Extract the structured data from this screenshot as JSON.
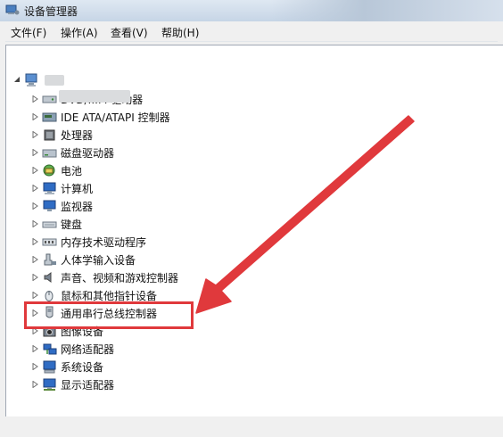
{
  "window": {
    "title": "设备管理器"
  },
  "menubar": [
    "文件(F)",
    "操作(A)",
    "查看(V)",
    "帮助(H)"
  ],
  "toolbar": [
    "back-icon",
    "forward-icon",
    "show-hide-tree-icon",
    "properties-icon",
    "help-icon",
    "action-pane-icon",
    "scan-hardware-icon"
  ],
  "tree": {
    "root_label_obscured": true,
    "items": [
      {
        "label": "DVD/...M 驱动器",
        "icon": "dvd-drive-icon"
      },
      {
        "label": "IDE ATA/ATAPI 控制器",
        "icon": "ide-controller-icon"
      },
      {
        "label": "处理器",
        "icon": "processor-icon"
      },
      {
        "label": "磁盘驱动器",
        "icon": "disk-drive-icon"
      },
      {
        "label": "电池",
        "icon": "battery-icon"
      },
      {
        "label": "计算机",
        "icon": "computer-icon"
      },
      {
        "label": "监视器",
        "icon": "monitor-icon"
      },
      {
        "label": "键盘",
        "icon": "keyboard-icon"
      },
      {
        "label": "内存技术驱动程序",
        "icon": "memory-icon"
      },
      {
        "label": "人体学输入设备",
        "icon": "hid-icon"
      },
      {
        "label": "声音、视频和游戏控制器",
        "icon": "sound-icon"
      },
      {
        "label": "鼠标和其他指针设备",
        "icon": "mouse-icon"
      },
      {
        "label": "通用串行总线控制器",
        "icon": "usb-icon"
      },
      {
        "label": "图像设备",
        "icon": "camera-icon"
      },
      {
        "label": "网络适配器",
        "icon": "network-icon"
      },
      {
        "label": "系统设备",
        "icon": "system-icon"
      },
      {
        "label": "显示适配器",
        "icon": "display-adapter-icon"
      }
    ]
  },
  "annotation": {
    "highlighted_item": "通用串行总线控制器",
    "color": "#e0393c"
  }
}
